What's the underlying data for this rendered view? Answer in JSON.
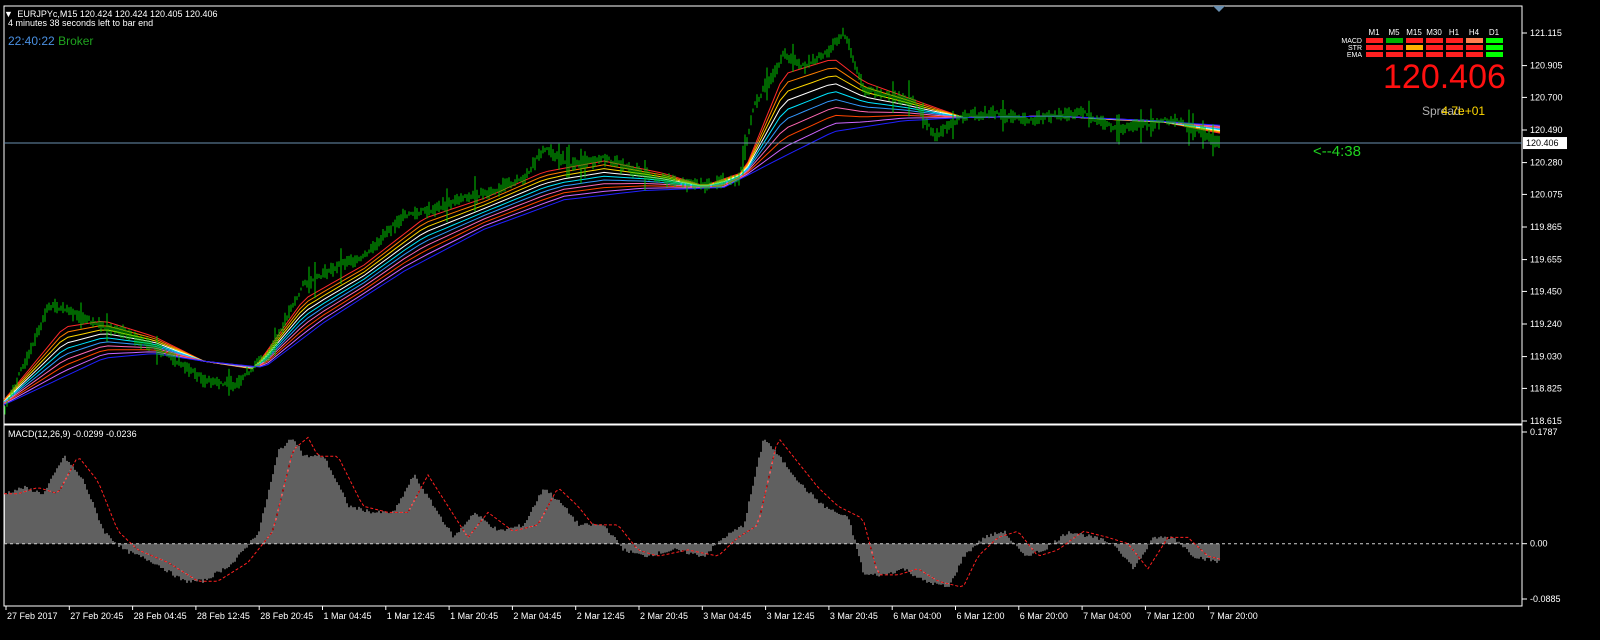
{
  "header": {
    "symbol_line": "EURJPYc,M15  120.424 120.424 120.405 120.406",
    "bar_timer": "4 minutes 38 seconds left to bar end",
    "clock": "22:40:22",
    "clock_label": "Broker",
    "countdown": "<--4:38"
  },
  "dashboard": {
    "timeframes": [
      "M1",
      "M5",
      "M15",
      "M30",
      "H1",
      "H4",
      "D1"
    ],
    "rows": [
      {
        "label": "MACD",
        "cells": [
          "#ff2020",
          "#00b000",
          "#ff2020",
          "#ff2020",
          "#ff2020",
          "#ff7f50",
          "#00ff00"
        ]
      },
      {
        "label": "STR",
        "cells": [
          "#ff2020",
          "#ff2020",
          "#ffb000",
          "#ff2020",
          "#ff2020",
          "#ff2020",
          "#00ff00"
        ]
      },
      {
        "label": "EMA",
        "cells": [
          "#ff2020",
          "#ff2020",
          "#ff2020",
          "#ff2020",
          "#ff2020",
          "#ff2020",
          "#00ff00"
        ]
      }
    ],
    "big_price": "120.406",
    "spread_label": "Spread:",
    "spread_value": "4.7e+01"
  },
  "chart_data": {
    "type": "candlestick",
    "price_panel": {
      "yticks": [
        "121.115",
        "120.905",
        "120.700",
        "120.490",
        "120.280",
        "120.075",
        "119.865",
        "119.655",
        "119.450",
        "119.240",
        "119.030",
        "118.825",
        "118.615"
      ],
      "ylim": [
        118.615,
        121.115
      ],
      "current_price": 120.406,
      "current_price_label": "120.406",
      "price_series": [
        [
          0,
          118.68
        ],
        [
          20,
          118.98
        ],
        [
          45,
          119.36
        ],
        [
          75,
          119.3
        ],
        [
          100,
          119.22
        ],
        [
          130,
          119.16
        ],
        [
          160,
          119.06
        ],
        [
          200,
          118.88
        ],
        [
          230,
          118.85
        ],
        [
          265,
          119.05
        ],
        [
          300,
          119.5
        ],
        [
          330,
          119.6
        ],
        [
          360,
          119.68
        ],
        [
          400,
          119.94
        ],
        [
          430,
          119.98
        ],
        [
          460,
          120.05
        ],
        [
          490,
          120.1
        ],
        [
          520,
          120.18
        ],
        [
          540,
          120.37
        ],
        [
          570,
          120.26
        ],
        [
          600,
          120.31
        ],
        [
          630,
          120.23
        ],
        [
          660,
          120.17
        ],
        [
          700,
          120.13
        ],
        [
          735,
          120.18
        ],
        [
          750,
          120.64
        ],
        [
          780,
          120.98
        ],
        [
          800,
          120.9
        ],
        [
          825,
          121.0
        ],
        [
          840,
          121.12
        ],
        [
          860,
          120.75
        ],
        [
          890,
          120.7
        ],
        [
          910,
          120.68
        ],
        [
          930,
          120.45
        ],
        [
          960,
          120.58
        ],
        [
          990,
          120.6
        ],
        [
          1020,
          120.55
        ],
        [
          1050,
          120.58
        ],
        [
          1080,
          120.6
        ],
        [
          1110,
          120.5
        ],
        [
          1140,
          120.52
        ],
        [
          1170,
          120.56
        ],
        [
          1195,
          120.48
        ],
        [
          1216,
          120.41
        ]
      ],
      "ema_fast": [
        [
          0,
          118.75
        ],
        [
          60,
          119.22
        ],
        [
          100,
          119.26
        ],
        [
          150,
          119.16
        ],
        [
          200,
          119.0
        ],
        [
          250,
          118.95
        ],
        [
          300,
          119.4
        ],
        [
          360,
          119.62
        ],
        [
          420,
          119.92
        ],
        [
          480,
          120.05
        ],
        [
          540,
          120.22
        ],
        [
          600,
          120.29
        ],
        [
          660,
          120.21
        ],
        [
          700,
          120.13
        ],
        [
          740,
          120.22
        ],
        [
          780,
          120.85
        ],
        [
          830,
          120.95
        ],
        [
          860,
          120.8
        ],
        [
          920,
          120.66
        ],
        [
          960,
          120.57
        ],
        [
          1050,
          120.58
        ],
        [
          1100,
          120.56
        ],
        [
          1160,
          120.54
        ],
        [
          1216,
          120.47
        ]
      ],
      "ema_slow": [
        [
          0,
          118.72
        ],
        [
          100,
          119.02
        ],
        [
          150,
          119.05
        ],
        [
          200,
          119.0
        ],
        [
          260,
          118.96
        ],
        [
          320,
          119.25
        ],
        [
          400,
          119.58
        ],
        [
          480,
          119.85
        ],
        [
          560,
          120.04
        ],
        [
          640,
          120.1
        ],
        [
          720,
          120.12
        ],
        [
          780,
          120.32
        ],
        [
          830,
          120.48
        ],
        [
          900,
          120.55
        ],
        [
          960,
          120.57
        ],
        [
          1050,
          120.58
        ],
        [
          1150,
          120.55
        ],
        [
          1216,
          120.52
        ]
      ],
      "ema_colors": [
        "#ff2a2a",
        "#ff7f00",
        "#ffd700",
        "#ffffff",
        "#00e5ff",
        "#3399ff",
        "#ff69b4",
        "#ff4500",
        "#cc66ff",
        "#2020ff"
      ]
    },
    "macd_panel": {
      "label": "MACD(12,26,9) -0.0299 -0.0236",
      "yticks": [
        "0.1787",
        "0.00",
        "-0.0885"
      ],
      "ylim": [
        -0.0885,
        0.1787
      ],
      "zero": 0.0,
      "histogram": [
        [
          0,
          0.08
        ],
        [
          20,
          0.09
        ],
        [
          40,
          0.08
        ],
        [
          60,
          0.14
        ],
        [
          80,
          0.1
        ],
        [
          100,
          0.02
        ],
        [
          120,
          -0.01
        ],
        [
          150,
          -0.03
        ],
        [
          180,
          -0.06
        ],
        [
          200,
          -0.06
        ],
        [
          230,
          -0.03
        ],
        [
          255,
          0.02
        ],
        [
          275,
          0.15
        ],
        [
          290,
          0.17
        ],
        [
          300,
          0.14
        ],
        [
          320,
          0.14
        ],
        [
          345,
          0.06
        ],
        [
          370,
          0.05
        ],
        [
          390,
          0.05
        ],
        [
          410,
          0.11
        ],
        [
          430,
          0.06
        ],
        [
          450,
          0.01
        ],
        [
          470,
          0.05
        ],
        [
          495,
          0.02
        ],
        [
          520,
          0.03
        ],
        [
          540,
          0.09
        ],
        [
          560,
          0.06
        ],
        [
          575,
          0.03
        ],
        [
          600,
          0.03
        ],
        [
          620,
          -0.01
        ],
        [
          640,
          -0.02
        ],
        [
          670,
          -0.01
        ],
        [
          700,
          -0.02
        ],
        [
          720,
          0.01
        ],
        [
          740,
          0.03
        ],
        [
          760,
          0.17
        ],
        [
          780,
          0.13
        ],
        [
          800,
          0.09
        ],
        [
          820,
          0.06
        ],
        [
          845,
          0.04
        ],
        [
          860,
          -0.05
        ],
        [
          880,
          -0.05
        ],
        [
          900,
          -0.04
        ],
        [
          920,
          -0.06
        ],
        [
          945,
          -0.07
        ],
        [
          960,
          -0.02
        ],
        [
          980,
          0.01
        ],
        [
          1000,
          0.02
        ],
        [
          1020,
          -0.02
        ],
        [
          1040,
          -0.01
        ],
        [
          1065,
          0.02
        ],
        [
          1090,
          0.01
        ],
        [
          1110,
          0.0
        ],
        [
          1130,
          -0.04
        ],
        [
          1150,
          0.01
        ],
        [
          1170,
          0.01
        ],
        [
          1190,
          -0.02
        ],
        [
          1216,
          -0.03
        ]
      ]
    },
    "xticks": [
      "27 Feb 2017",
      "27 Feb 20:45",
      "28 Feb 04:45",
      "28 Feb 12:45",
      "28 Feb 20:45",
      "1 Mar 04:45",
      "1 Mar 12:45",
      "1 Mar 20:45",
      "2 Mar 04:45",
      "2 Mar 12:45",
      "2 Mar 20:45",
      "3 Mar 04:45",
      "3 Mar 12:45",
      "3 Mar 20:45",
      "6 Mar 04:00",
      "6 Mar 12:00",
      "6 Mar 20:00",
      "7 Mar 04:00",
      "7 Mar 12:00",
      "7 Mar 20:00"
    ],
    "xlim": [
      0,
      1520
    ],
    "grid": false,
    "colors": {
      "bars": "#00c800",
      "background": "#000000",
      "axis": "#ffffff",
      "macd_hist": "#c0c0c0",
      "macd_signal": "#ff2020",
      "current_line": "#6a8fb0"
    }
  }
}
